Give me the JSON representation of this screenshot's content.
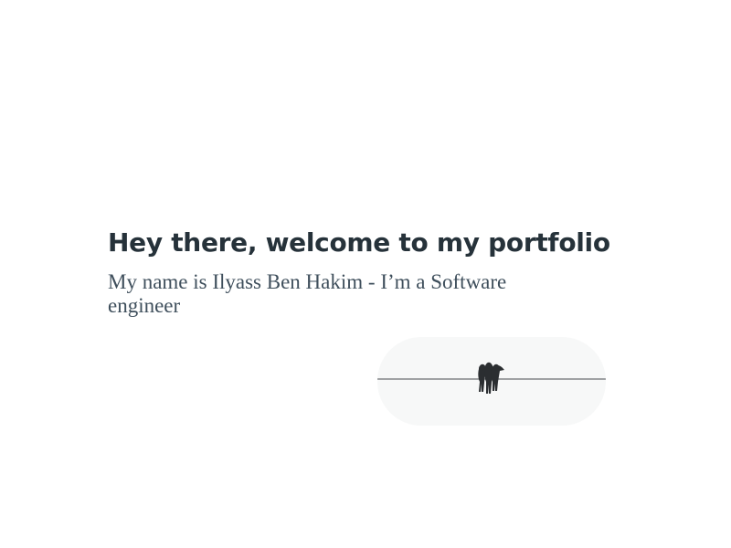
{
  "hero": {
    "headline": "Hey there, welcome to my portfolio",
    "subline": "My name is Ilyass Ben Hakim - I’m a Software engineer"
  },
  "photo": {
    "subject": "birds-on-wire-illustration"
  },
  "colors": {
    "headline": "#26323a",
    "subline": "#3f4f5c",
    "photo_background": "#f7f8f8",
    "wire": "#6b6f72",
    "birds": "#2b2e31"
  }
}
